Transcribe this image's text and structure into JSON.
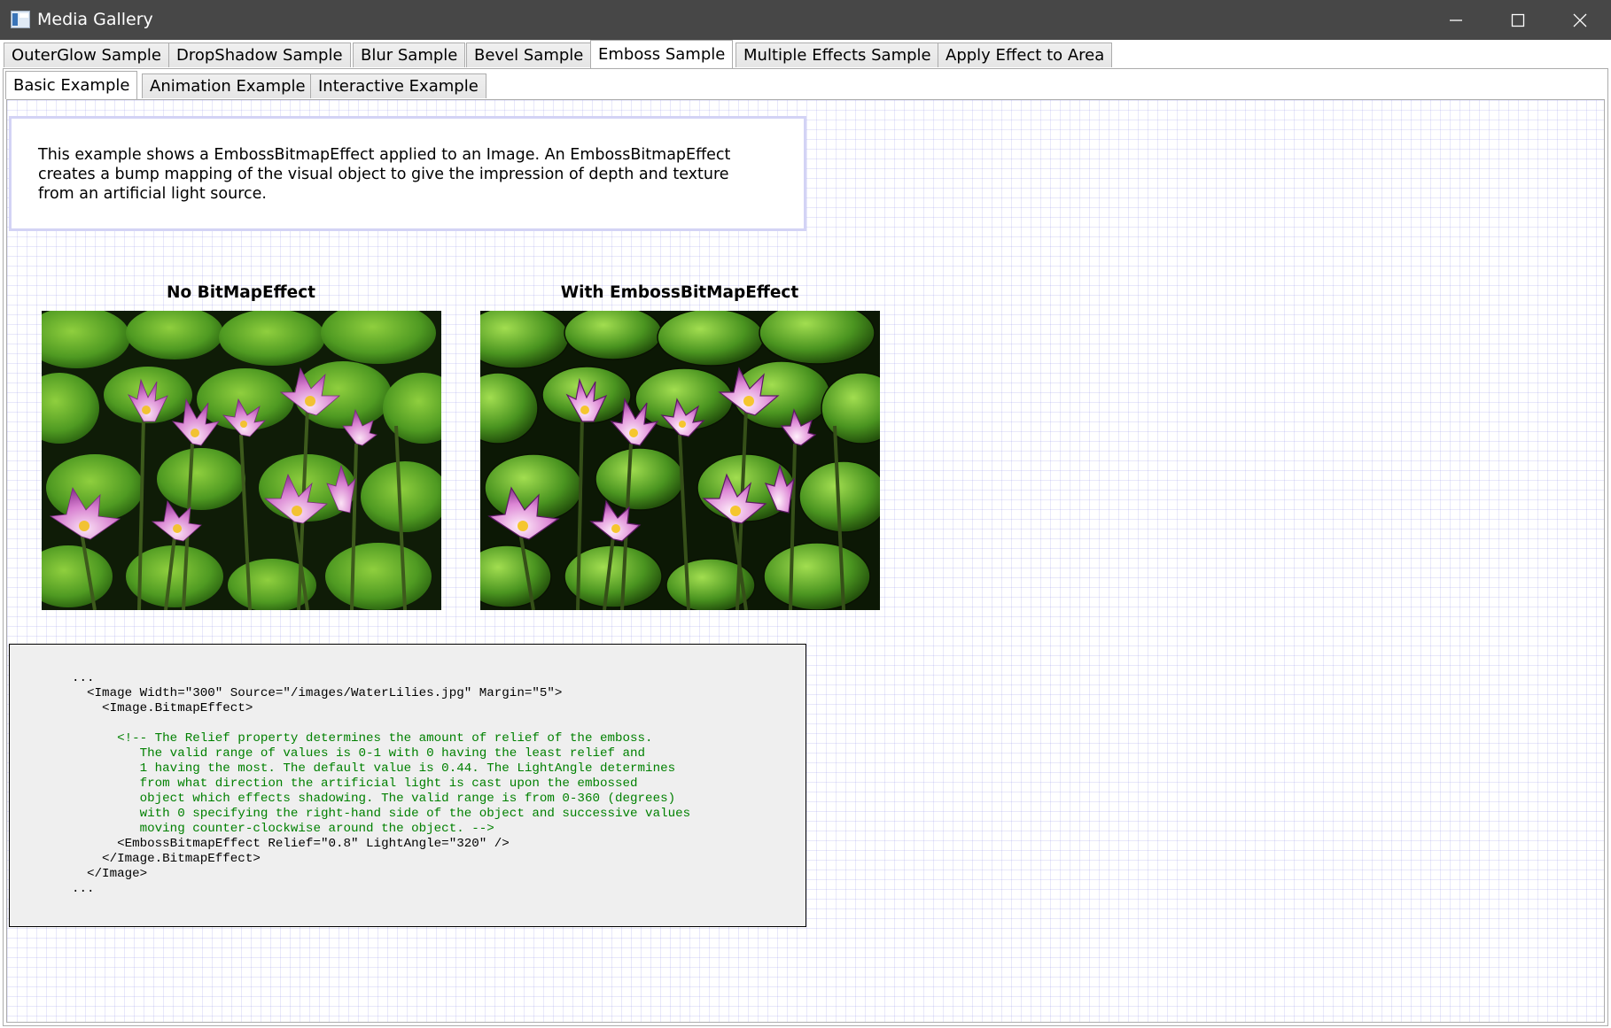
{
  "window": {
    "title": "Media Gallery"
  },
  "outer_tabs": [
    {
      "label": "OuterGlow Sample",
      "selected": false
    },
    {
      "label": "DropShadow Sample",
      "selected": false
    },
    {
      "label": "Blur Sample",
      "selected": false
    },
    {
      "label": "Bevel Sample",
      "selected": false
    },
    {
      "label": "Emboss Sample",
      "selected": true
    },
    {
      "label": "Multiple Effects Sample",
      "selected": false
    },
    {
      "label": "Apply Effect to Area",
      "selected": false
    }
  ],
  "inner_tabs": [
    {
      "label": "Basic Example",
      "selected": true
    },
    {
      "label": "Animation Example",
      "selected": false
    },
    {
      "label": "Interactive Example",
      "selected": false
    }
  ],
  "description": {
    "line1": "This example shows a EmbossBitmapEffect applied to an Image. An EmbossBitmapEffect",
    "line2": "creates a bump mapping of the visual object to give the impression of depth and texture",
    "line3": "from an artificial light source."
  },
  "images": {
    "left_label": "No BitMapEffect",
    "right_label": "With EmbossBitMapEffect"
  },
  "code": {
    "l01": "...",
    "l02": "  <Image Width=\"300\" Source=\"/images/WaterLilies.jpg\" Margin=\"5\">",
    "l03": "    <Image.BitmapEffect>",
    "l04": "      <!-- The Relief property determines the amount of relief of the emboss.",
    "l05": "         The valid range of values is 0-1 with 0 having the least relief and",
    "l06": "         1 having the most. The default value is 0.44. The LightAngle determines",
    "l07": "         from what direction the artificial light is cast upon the embossed",
    "l08": "         object which effects shadowing. The valid range is from 0-360 (degrees)",
    "l09": "         with 0 specifying the right-hand side of the object and successive values",
    "l10": "         moving counter-clockwise around the object. -->",
    "l11": "      <EmbossBitmapEffect Relief=\"0.8\" LightAngle=\"320\" />",
    "l12": "    </Image.BitmapEffect>",
    "l13": "  </Image>",
    "l14": "..."
  },
  "colors": {
    "titlebar": "#474747",
    "comment": "#008000",
    "grid": "#d6d6f5"
  }
}
